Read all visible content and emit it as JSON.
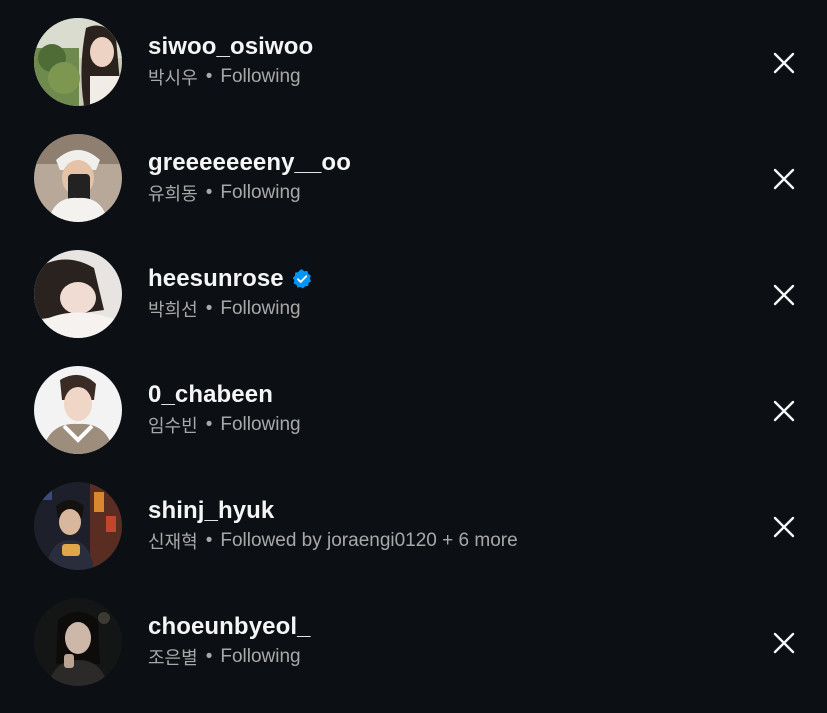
{
  "colors": {
    "background": "#0c1014",
    "primary_text": "#f5f5f5",
    "secondary_text": "#a8a8a8",
    "verified_blue": "#0095f6"
  },
  "separator": "•",
  "accounts": [
    {
      "username": "siwoo_osiwoo",
      "real_name": "박시우",
      "status": "Following",
      "verified": false,
      "avatar_icon": "profile-photo"
    },
    {
      "username": "greeeeeeeny__oo",
      "real_name": "유희동",
      "status": "Following",
      "verified": false,
      "avatar_icon": "profile-photo"
    },
    {
      "username": "heesunrose",
      "real_name": "박희선",
      "status": "Following",
      "verified": true,
      "avatar_icon": "profile-photo"
    },
    {
      "username": "0_chabeen",
      "real_name": "임수빈",
      "status": "Following",
      "verified": false,
      "avatar_icon": "profile-photo"
    },
    {
      "username": "shinj_hyuk",
      "real_name": "신재혁",
      "status": "Followed by joraengi0120 + 6 more",
      "verified": false,
      "avatar_icon": "profile-photo"
    },
    {
      "username": "choeunbyeol_",
      "real_name": "조은별",
      "status": "Following",
      "verified": false,
      "avatar_icon": "profile-photo"
    }
  ],
  "remove_icon": "close-icon",
  "verified_icon": "verified-badge-icon"
}
